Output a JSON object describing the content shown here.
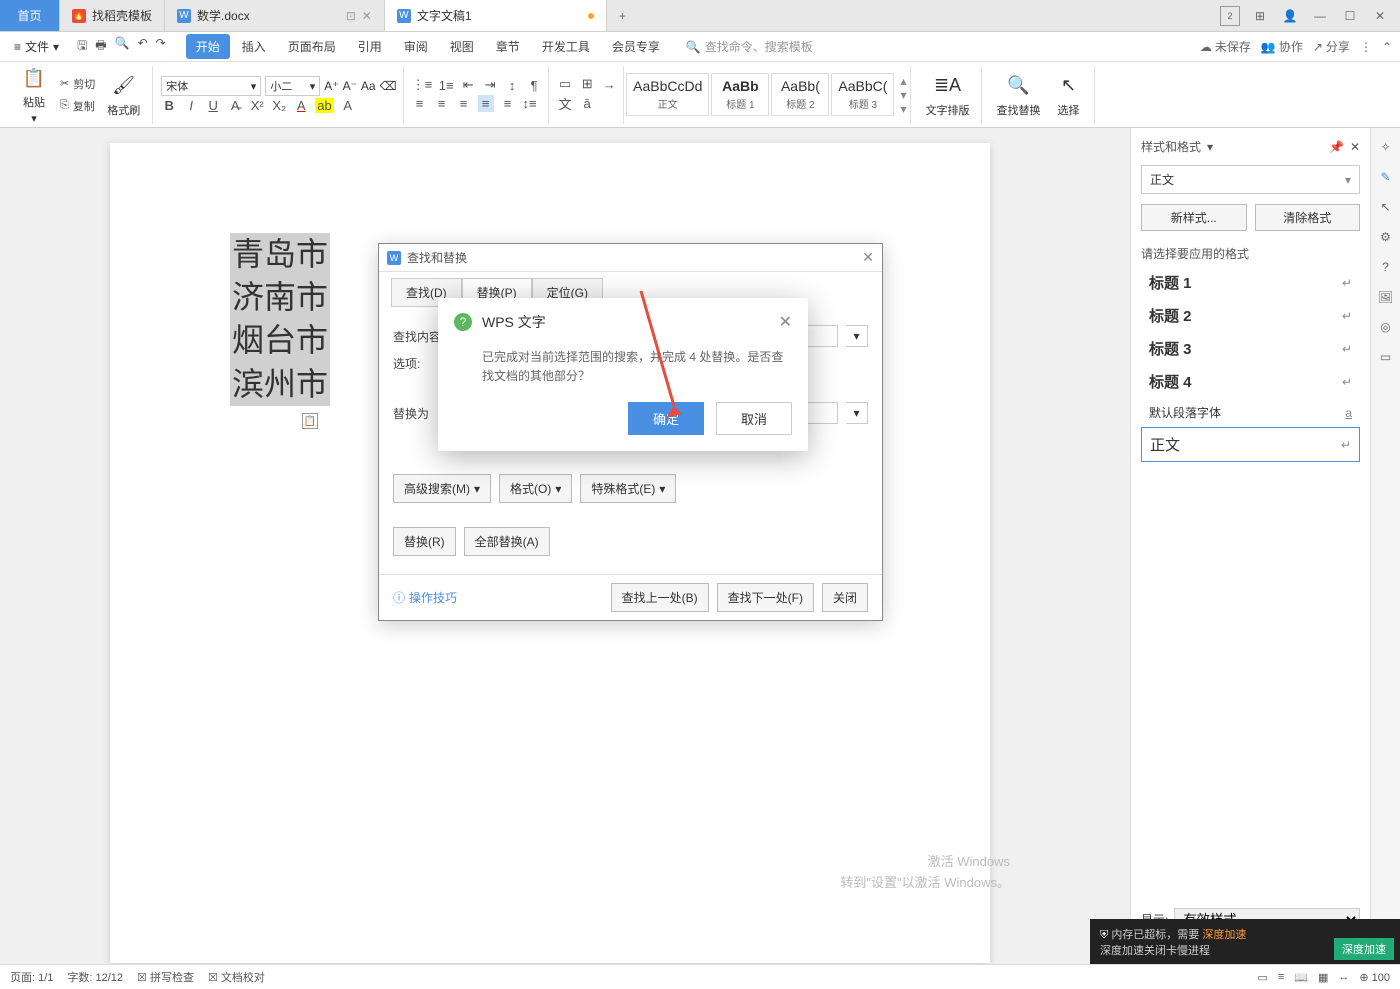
{
  "tabs": {
    "home": "首页",
    "t1": "找稻壳模板",
    "t2": "数学.docx",
    "t3": "文字文稿1"
  },
  "menu": {
    "file": "文件",
    "items": [
      "开始",
      "插入",
      "页面布局",
      "引用",
      "审阅",
      "视图",
      "章节",
      "开发工具",
      "会员专享"
    ],
    "search_ph": "查找命令、搜索模板",
    "unsaved": "未保存",
    "coop": "协作",
    "share": "分享"
  },
  "ribbon": {
    "paste": "粘贴",
    "cut": "剪切",
    "copy": "复制",
    "fmtpaint": "格式刷",
    "font_name": "宋体",
    "font_size": "小二",
    "styles": [
      {
        "preview": "AaBbCcDd",
        "label": "正文"
      },
      {
        "preview": "AaBb",
        "label": "标题 1"
      },
      {
        "preview": "AaBb(",
        "label": "标题 2"
      },
      {
        "preview": "AaBbC(",
        "label": "标题 3"
      }
    ],
    "text_layout": "文字排版",
    "find_replace": "查找替换",
    "select": "选择"
  },
  "doc_lines": [
    "青岛市",
    "济南市",
    "烟台市",
    "滨州市"
  ],
  "find_dlg": {
    "title": "查找和替换",
    "tabs": {
      "find": "查找(D)",
      "replace": "替换(P)",
      "goto": "定位(G)"
    },
    "find_label": "查找内容",
    "options_label": "选项:",
    "replace_label": "替换为",
    "adv": "高级搜索(M)",
    "format": "格式(O)",
    "special": "特殊格式(E)",
    "replace_btn": "替换(R)",
    "replace_all": "全部替换(A)",
    "tips": "操作技巧",
    "find_prev": "查找上一处(B)",
    "find_next": "查找下一处(F)",
    "close": "关闭"
  },
  "msg": {
    "title": "WPS 文字",
    "body": "已完成对当前选择范围的搜索，并完成 4 处替换。是否查找文档的其他部分？",
    "ok": "确定",
    "cancel": "取消"
  },
  "panel": {
    "title": "样式和格式",
    "current": "正文",
    "new_style": "新样式...",
    "clear": "清除格式",
    "prompt": "请选择要应用的格式",
    "styles": [
      "标题 1",
      "标题 2",
      "标题 3",
      "标题 4",
      "默认段落字体",
      "正文"
    ],
    "show": "显示:",
    "show_val": "有效样式"
  },
  "status": {
    "page": "页面: 1/1",
    "words": "字数: 12/12",
    "spell": "拼写检查",
    "proof": "文档校对",
    "zoom": "100"
  },
  "watermark": {
    "l1": "激活 Windows",
    "l2": "转到\"设置\"以激活 Windows。"
  },
  "overlay": {
    "l1_a": "内存已超标，需要 ",
    "l1_b": "深度加速",
    "l2": "深度加速关闭卡慢进程",
    "btn": "深度加速"
  }
}
